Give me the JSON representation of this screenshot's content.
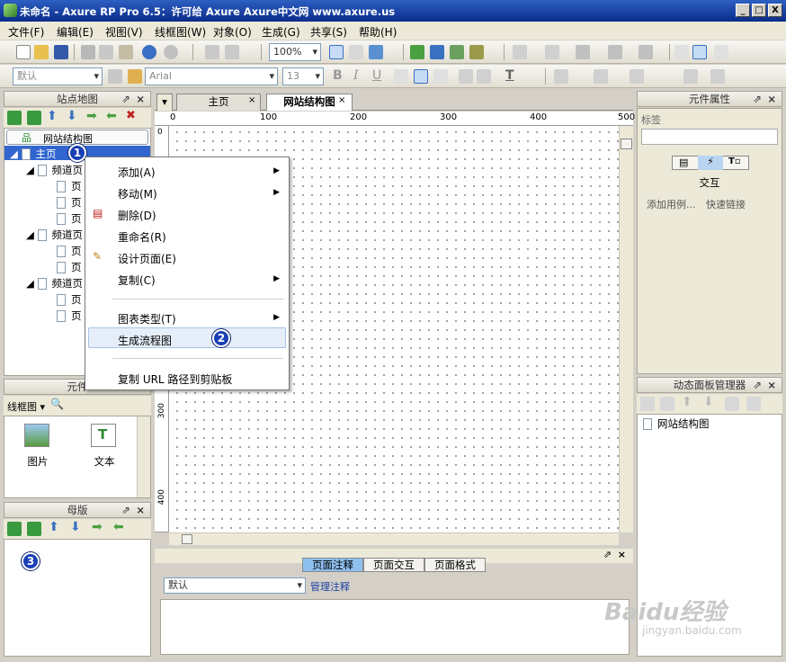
{
  "window": {
    "title": "未命名 - Axure RP Pro 6.5：许可给 Axure Axure中文网 www.axure.us",
    "min": "_",
    "max": "□",
    "close": "X"
  },
  "menu": [
    "文件(F)",
    "编辑(E)",
    "视图(V)",
    "线框图(W)",
    "对象(O)",
    "生成(G)",
    "共享(S)",
    "帮助(H)"
  ],
  "toolbar": {
    "zoom": "100%",
    "style": "默认",
    "font": "Arial",
    "size": "13",
    "bold": "B",
    "italic": "I",
    "underline": "U",
    "font_color": "T"
  },
  "sitemap": {
    "title": "站点地图",
    "root_label": "网站结构图",
    "home": "主页",
    "ch1": "频道页",
    "ch2": "频道页",
    "ch3": "频道页",
    "page": "页"
  },
  "context_menu": {
    "items": [
      "添加(A)",
      "移动(M)",
      "删除(D)",
      "重命名(R)",
      "设计页面(E)",
      "复制(C)",
      "图表类型(T)",
      "生成流程图",
      "复制 URL 路径到剪贴板"
    ]
  },
  "widgets": {
    "title": "元件",
    "library": "线框图",
    "image": "图片",
    "text": "文本"
  },
  "masters": {
    "title": "母版"
  },
  "tabs": {
    "home": "主页",
    "sitemap_tab": "网站结构图"
  },
  "ruler": {
    "h": [
      "0",
      "100",
      "200",
      "300",
      "400",
      "500"
    ],
    "v": [
      "0",
      "300",
      "400"
    ]
  },
  "notes": {
    "tab1": "页面注释",
    "tab2": "页面交互",
    "tab3": "页面格式",
    "select": "默认",
    "manage": "管理注释"
  },
  "props": {
    "title": "元件属性",
    "label": "标签",
    "interaction": "交互",
    "add_case": "添加用例...",
    "quick_link": "快速链接"
  },
  "dynamic": {
    "title": "动态面板管理器",
    "item": "网站结构图"
  },
  "badges": [
    "1",
    "2",
    "3"
  ],
  "watermark": {
    "brand": "Baidu经验",
    "url": "jingyan.baidu.com"
  }
}
